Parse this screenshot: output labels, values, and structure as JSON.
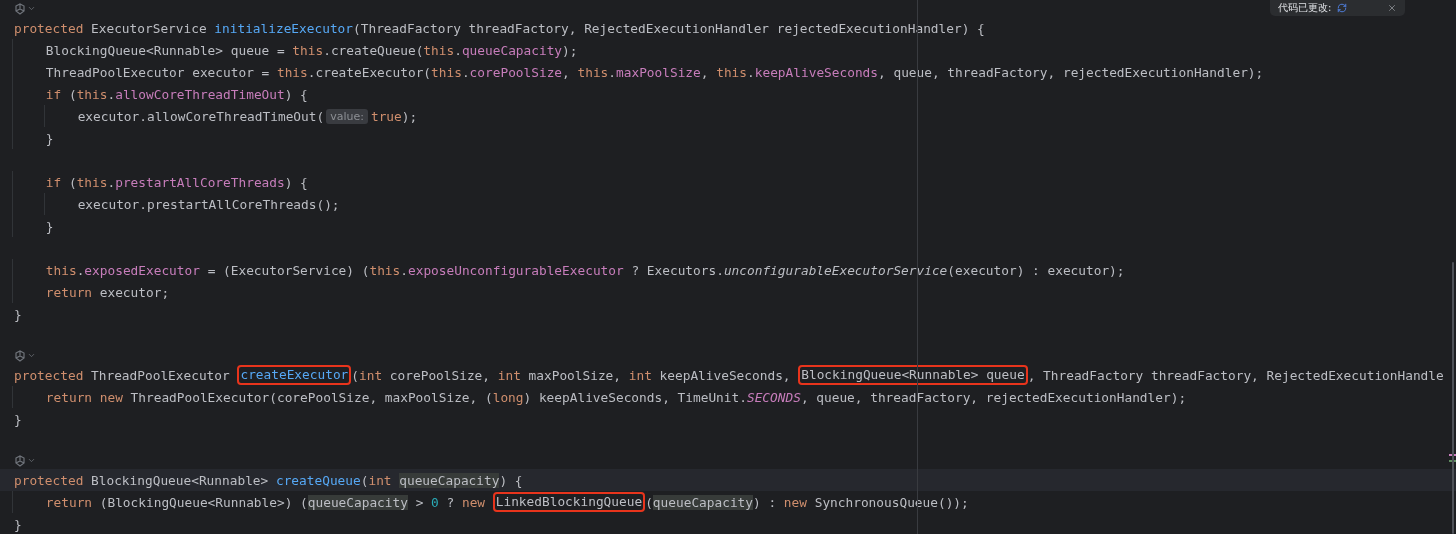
{
  "popup": {
    "text": "代码已更改:"
  },
  "lines": [
    {
      "kind": "gutter"
    },
    {
      "kind": "code",
      "tokens": [
        {
          "t": "protected ",
          "kind": "kw"
        },
        {
          "t": "ExecutorService ",
          "kind": "plain"
        },
        {
          "t": "initializeExecutor",
          "kind": "fn"
        },
        {
          "t": "(ThreadFactory threadFactory, RejectedExecutionHandler rejectedExecutionHandler) {",
          "kind": "plain"
        }
      ],
      "children": [
        {
          "kind": "code",
          "tokens": [
            {
              "t": "BlockingQueue<Runnable> queue = ",
              "kind": "plain"
            },
            {
              "t": "this",
              "kind": "kw"
            },
            {
              "t": ".createQueue(",
              "kind": "plain"
            },
            {
              "t": "this",
              "kind": "kw"
            },
            {
              "t": ".",
              "kind": "plain"
            },
            {
              "t": "queueCapacity",
              "kind": "field"
            },
            {
              "t": ");",
              "kind": "plain"
            }
          ]
        },
        {
          "kind": "code",
          "tokens": [
            {
              "t": "ThreadPoolExecutor executor = ",
              "kind": "plain"
            },
            {
              "t": "this",
              "kind": "kw"
            },
            {
              "t": ".createExecutor(",
              "kind": "plain"
            },
            {
              "t": "this",
              "kind": "kw"
            },
            {
              "t": ".",
              "kind": "plain"
            },
            {
              "t": "corePoolSize",
              "kind": "field"
            },
            {
              "t": ", ",
              "kind": "plain"
            },
            {
              "t": "this",
              "kind": "kw"
            },
            {
              "t": ".",
              "kind": "plain"
            },
            {
              "t": "maxPoolSize",
              "kind": "field"
            },
            {
              "t": ", ",
              "kind": "plain"
            },
            {
              "t": "this",
              "kind": "kw"
            },
            {
              "t": ".",
              "kind": "plain"
            },
            {
              "t": "keepAliveSeconds",
              "kind": "field"
            },
            {
              "t": ", queue, threadFactory, rejectedExecutionHandler);",
              "kind": "plain"
            }
          ]
        },
        {
          "kind": "code",
          "tokens": [
            {
              "t": "if ",
              "kind": "kw"
            },
            {
              "t": "(",
              "kind": "plain"
            },
            {
              "t": "this",
              "kind": "kw"
            },
            {
              "t": ".",
              "kind": "plain"
            },
            {
              "t": "allowCoreThreadTimeOut",
              "kind": "field"
            },
            {
              "t": ") {",
              "kind": "plain"
            }
          ],
          "children": [
            {
              "kind": "code",
              "tokens": [
                {
                  "t": "executor.allowCoreThreadTimeOut(",
                  "kind": "plain"
                },
                {
                  "t": "value:",
                  "kind": "hint"
                },
                {
                  "t": "true",
                  "kind": "kw"
                },
                {
                  "t": ");",
                  "kind": "plain"
                }
              ]
            }
          ]
        },
        {
          "kind": "code",
          "tokens": [
            {
              "t": "}",
              "kind": "plain"
            }
          ]
        },
        {
          "kind": "blank"
        },
        {
          "kind": "code",
          "tokens": [
            {
              "t": "if ",
              "kind": "kw"
            },
            {
              "t": "(",
              "kind": "plain"
            },
            {
              "t": "this",
              "kind": "kw"
            },
            {
              "t": ".",
              "kind": "plain"
            },
            {
              "t": "prestartAllCoreThreads",
              "kind": "field"
            },
            {
              "t": ") {",
              "kind": "plain"
            }
          ],
          "children": [
            {
              "kind": "code",
              "tokens": [
                {
                  "t": "executor.prestartAllCoreThreads();",
                  "kind": "plain"
                }
              ]
            }
          ]
        },
        {
          "kind": "code",
          "tokens": [
            {
              "t": "}",
              "kind": "plain"
            }
          ]
        },
        {
          "kind": "blank"
        },
        {
          "kind": "code",
          "tokens": [
            {
              "t": "this",
              "kind": "kw"
            },
            {
              "t": ".",
              "kind": "plain"
            },
            {
              "t": "exposedExecutor",
              "kind": "field"
            },
            {
              "t": " = (ExecutorService) (",
              "kind": "plain"
            },
            {
              "t": "this",
              "kind": "kw"
            },
            {
              "t": ".",
              "kind": "plain"
            },
            {
              "t": "exposeUnconfigurableExecutor",
              "kind": "field"
            },
            {
              "t": " ? Executors.",
              "kind": "plain"
            },
            {
              "t": "unconfigurableExecutorService",
              "kind": "italic"
            },
            {
              "t": "(executor) : executor);",
              "kind": "plain"
            }
          ]
        },
        {
          "kind": "code",
          "tokens": [
            {
              "t": "return ",
              "kind": "kw"
            },
            {
              "t": "executor;",
              "kind": "plain"
            }
          ]
        }
      ]
    },
    {
      "kind": "code",
      "tokens": [
        {
          "t": "}",
          "kind": "plain"
        }
      ]
    },
    {
      "kind": "blank"
    },
    {
      "kind": "gutter"
    },
    {
      "kind": "code",
      "tokens": [
        {
          "t": "protected ",
          "kind": "kw"
        },
        {
          "t": "ThreadPoolExecutor ",
          "kind": "plain"
        },
        {
          "t": "createExecutor",
          "kind": "fn",
          "boxed": true
        },
        {
          "t": "(",
          "kind": "plain"
        },
        {
          "t": "int ",
          "kind": "kw"
        },
        {
          "t": "corePoolSize, ",
          "kind": "plain"
        },
        {
          "t": "int ",
          "kind": "kw"
        },
        {
          "t": "maxPoolSize, ",
          "kind": "plain"
        },
        {
          "t": "int ",
          "kind": "kw"
        },
        {
          "t": "keepAliveSeconds, ",
          "kind": "plain"
        },
        {
          "t": "BlockingQueue<Runnable> queue",
          "kind": "plain",
          "boxed": true
        },
        {
          "t": ", ThreadFactory threadFactory, RejectedExecutionHandle",
          "kind": "plain"
        }
      ],
      "children": [
        {
          "kind": "code",
          "tokens": [
            {
              "t": "return new ",
              "kind": "kw"
            },
            {
              "t": "ThreadPoolExecutor(corePoolSize, maxPoolSize, (",
              "kind": "plain"
            },
            {
              "t": "long",
              "kind": "kw"
            },
            {
              "t": ") keepAliveSeconds, TimeUnit.",
              "kind": "plain"
            },
            {
              "t": "SECONDS",
              "kind": "static"
            },
            {
              "t": ", queue, threadFactory, rejectedExecutionHandler);",
              "kind": "plain"
            }
          ]
        }
      ]
    },
    {
      "kind": "code",
      "tokens": [
        {
          "t": "}",
          "kind": "plain"
        }
      ]
    },
    {
      "kind": "blank"
    },
    {
      "kind": "gutter"
    },
    {
      "kind": "code",
      "current": true,
      "tokens": [
        {
          "t": "protected ",
          "kind": "kw"
        },
        {
          "t": "BlockingQueue<Runnable> ",
          "kind": "plain"
        },
        {
          "t": "createQueue",
          "kind": "fn"
        },
        {
          "t": "(",
          "kind": "plain"
        },
        {
          "t": "int ",
          "kind": "kw"
        },
        {
          "t": "queueCapacity",
          "kind": "ref"
        },
        {
          "t": ") {",
          "kind": "plain"
        }
      ],
      "children": [
        {
          "kind": "code",
          "tokens": [
            {
              "t": "return ",
              "kind": "kw"
            },
            {
              "t": "(BlockingQueue<Runnable>) (",
              "kind": "plain"
            },
            {
              "t": "queueCapacity",
              "kind": "ref"
            },
            {
              "t": " > ",
              "kind": "plain"
            },
            {
              "t": "0",
              "kind": "num"
            },
            {
              "t": " ? ",
              "kind": "plain"
            },
            {
              "t": "new ",
              "kind": "kw"
            },
            {
              "t": "LinkedBlockingQueue",
              "kind": "plain",
              "boxed": true
            },
            {
              "t": "(",
              "kind": "plain"
            },
            {
              "t": "queueCapacity",
              "kind": "ref"
            },
            {
              "t": ") : ",
              "kind": "plain"
            },
            {
              "t": "new ",
              "kind": "kw"
            },
            {
              "t": "SynchronousQueue());",
              "kind": "plain"
            }
          ]
        }
      ]
    },
    {
      "kind": "code",
      "tokens": [
        {
          "t": "}",
          "kind": "plain"
        }
      ]
    }
  ]
}
